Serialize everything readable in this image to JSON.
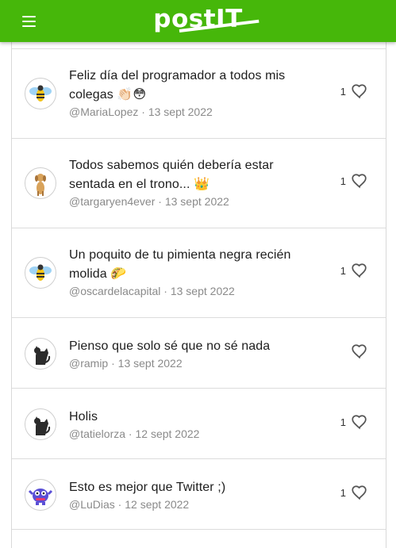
{
  "app": {
    "brand": "postIT"
  },
  "colors": {
    "primary": "#46b70a",
    "meta": "#8a8a8a",
    "heart": "#555555"
  },
  "icons": {
    "menu": "menu-icon",
    "like": "heart-outline-icon"
  },
  "posts": [
    {
      "text": "Feliz día del programador a todos mis colegas 👏🏻😳",
      "user": "@MariaLopez",
      "date": "13 sept 2022",
      "likes": "1",
      "avatar": "bee-avatar"
    },
    {
      "text": "Todos sabemos quién debería estar sentada en el trono... 👑",
      "user": "@targaryen4ever",
      "date": "13 sept 2022",
      "likes": "1",
      "avatar": "dog-avatar"
    },
    {
      "text": "Un poquito de tu pimienta negra recién molida 🌮",
      "user": "@oscardelacapital",
      "date": "13 sept 2022",
      "likes": "1",
      "avatar": "bee-avatar"
    },
    {
      "text": "Pienso que solo sé que no sé nada",
      "user": "@ramip",
      "date": "13 sept 2022",
      "likes": "",
      "avatar": "cat-avatar"
    },
    {
      "text": "Holis",
      "user": "@tatielorza",
      "date": "12 sept 2022",
      "likes": "1",
      "avatar": "cat-avatar"
    },
    {
      "text": "Esto es mejor que Twitter ;)",
      "user": "@LuDias",
      "date": "12 sept 2022",
      "likes": "1",
      "avatar": "monster-avatar"
    }
  ],
  "separator": " · "
}
